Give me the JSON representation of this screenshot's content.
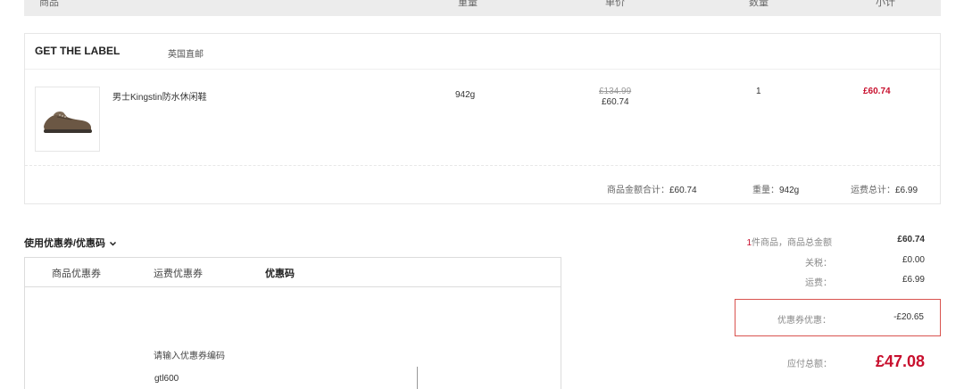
{
  "table_header": {
    "product": "商品",
    "weight": "重量",
    "unit_price": "单价",
    "quantity": "数量",
    "subtotal": "小计"
  },
  "store": {
    "name": "GET THE LABEL",
    "shipping": "英国直邮",
    "item": {
      "icon": "shoe-thumbnail",
      "name": "男士Kingstin防水休闲鞋",
      "weight": "942g",
      "original_price": "£134.99",
      "price": "£60.74",
      "quantity": "1",
      "subtotal": "£60.74"
    },
    "footer": {
      "goods_total_label": "商品金额合计：",
      "goods_total_value": "£60.74",
      "weight_label": "重量：",
      "weight_value": "942g",
      "shipping_label": "运费总计：",
      "shipping_value": "£6.99"
    }
  },
  "coupon": {
    "title": "使用优惠券/优惠码",
    "tabs": [
      "商品优惠券",
      "运费优惠券",
      "优惠码"
    ],
    "active_tab": "优惠码",
    "code_label": "请输入优惠券编码",
    "code_value": "gtl600"
  },
  "summary": {
    "item_count": "1",
    "goods_label": "件商品，商品总金额",
    "goods_value": "£60.74",
    "tax_label": "关税：",
    "tax_value": "£0.00",
    "shipping_label": "运费：",
    "shipping_value": "£6.99",
    "discount_label": "优惠券优惠：",
    "discount_value": "-£20.65",
    "total_label": "应付总额：",
    "total_value": "£47.08"
  },
  "colors": {
    "accent_red": "#c8102e",
    "discount_border": "#d9534f"
  }
}
